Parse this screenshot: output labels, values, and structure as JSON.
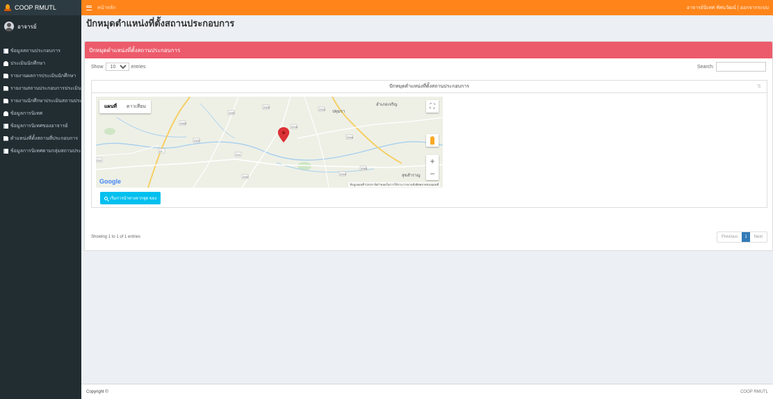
{
  "brand": {
    "name": "COOP RMUTL"
  },
  "user": {
    "name": "อาจารย์"
  },
  "sidebar": {
    "items": [
      {
        "label": "ข้อมูลสถานประกอบการ",
        "icon": "book-icon"
      },
      {
        "label": "ประเมินนักศึกษา",
        "icon": "person-icon"
      },
      {
        "label": "รายงานผลการประเมินนักศึกษา",
        "icon": "document-icon"
      },
      {
        "label": "รายงานสถานประกอบการประเมิน",
        "icon": "document-icon"
      },
      {
        "label": "รายงานนักศึกษาประเมินสถานประกอบการ",
        "icon": "document-icon"
      },
      {
        "label": "ข้อมูลการนิเทศ",
        "icon": "person-icon"
      },
      {
        "label": "ข้อมูลการนิเทศของอาจารย์",
        "icon": "book-icon"
      },
      {
        "label": "ตำแหน่งที่ตั้งสถานที่ประกอบการ",
        "icon": "document-icon"
      },
      {
        "label": "ข้อมูลการนิเทศตามกลุ่มสถานประกอบการ",
        "icon": "book-icon"
      }
    ]
  },
  "topbar": {
    "breadcrumb": "หน้าหลัก",
    "user_link": "อาจารย์นิเทศ ทัศนวัฒน์ | ออกจากระบบ"
  },
  "page": {
    "title": "ปักหมุดตำแหน่งที่ตั้งสถานประกอบการ"
  },
  "box": {
    "header": "ปักหมุดตำแหน่งที่ตั้งสถานประกอบการ"
  },
  "datatable": {
    "show_label": "Show",
    "length_value": "10",
    "entries_label": "entries",
    "search_label": "Search:",
    "column_header": "ปักหมุดตำแหน่งที่ตั้งสถานประกอบการ",
    "info": "Showing 1 to 1 of 1 entries",
    "prev": "Previous",
    "page": "1",
    "next": "Next"
  },
  "map": {
    "type_map": "แผนที่",
    "type_satellite": "ดาวเทียม",
    "logo": "Google",
    "attribution": "ข้อมูลแผนที่ ©2020 ข้อกำหนดในการใช้งาน รายงานข้อผิดพลาดของแผนที่",
    "labels": [
      "อำเภอเจริญ",
      "ปทุมรา",
      "สุขสำราญ"
    ],
    "road_numbers": [
      "2083",
      "2287",
      "2302",
      "2216",
      "2310",
      "2337",
      "23",
      "214",
      "2044"
    ],
    "marker_color": "#db3236"
  },
  "action_button": {
    "label": "เริ่มการนำทางจากจุด ของ"
  },
  "footer": {
    "copyright": "Copyright ©",
    "right": "COOP RMUTL"
  },
  "colors": {
    "topbar": "#ff851b",
    "sidebar": "#222d32",
    "box_header": "#ec5b6b",
    "button": "#00c0ef"
  }
}
